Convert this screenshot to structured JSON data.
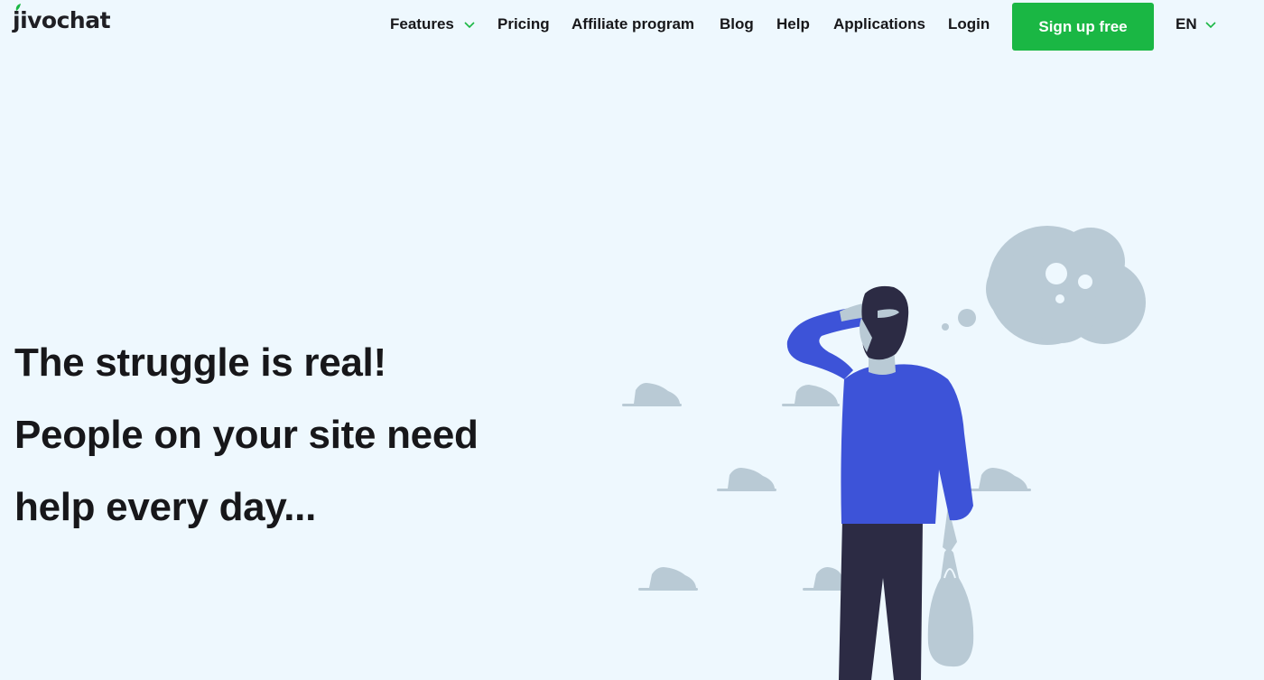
{
  "brand": {
    "name": "jivochat",
    "accent": "#1ab744"
  },
  "nav": {
    "features": "Features",
    "pricing": "Pricing",
    "affiliate": "Affiliate program",
    "blog": "Blog",
    "help": "Help",
    "applications": "Applications",
    "login": "Login",
    "signup": "Sign up free",
    "lang": "EN"
  },
  "hero": {
    "line1": "The struggle is real!",
    "line2": "People on your site need",
    "line3": "help every day..."
  },
  "icons": {
    "features_dropdown": "chevron-down-icon",
    "lang_dropdown": "chevron-down-icon"
  },
  "colors": {
    "background": "#eef8fe",
    "shirt": "#3d53d8",
    "pants": "#2c2b44",
    "skin": "#b9cad5",
    "cloud": "#b9cad5",
    "signup_button": "#1ab744"
  }
}
